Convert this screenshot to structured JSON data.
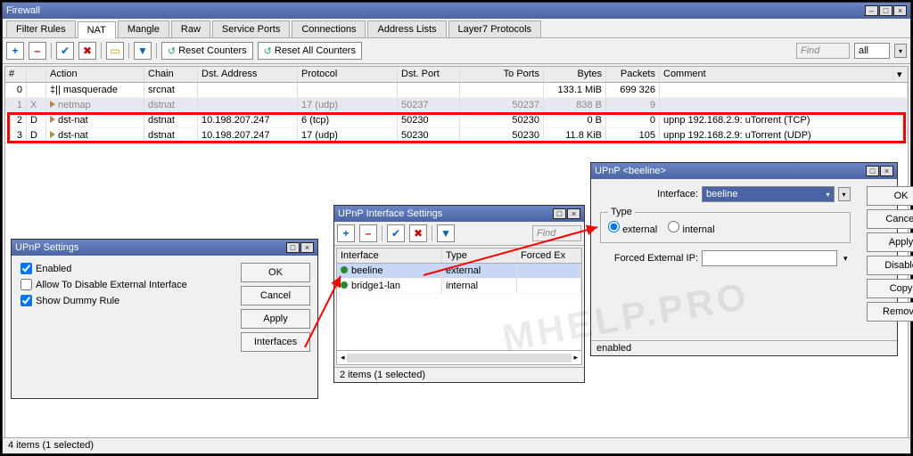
{
  "main": {
    "title": "Firewall",
    "tabs": [
      "Filter Rules",
      "NAT",
      "Mangle",
      "Raw",
      "Service Ports",
      "Connections",
      "Address Lists",
      "Layer7 Protocols"
    ],
    "active_tab": "NAT",
    "toolbar": {
      "reset_counters": "Reset Counters",
      "reset_all": "Reset All Counters",
      "find": "Find",
      "all": "all"
    },
    "columns": [
      "#",
      "",
      "Action",
      "Chain",
      "Dst. Address",
      "Protocol",
      "Dst. Port",
      "To Ports",
      "Bytes",
      "Packets",
      "Comment"
    ],
    "rows": [
      {
        "n": "0",
        "flag": "",
        "action": "‡|| masquerade",
        "chain": "srcnat",
        "dst": "",
        "proto": "",
        "dport": "",
        "to": "",
        "bytes": "133.1 MiB",
        "pkts": "699 326",
        "comment": ""
      },
      {
        "n": "1",
        "flag": "X",
        "action": "▸ netmap",
        "chain": "dstnat",
        "dst": "",
        "proto": "17 (udp)",
        "dport": "50237",
        "to": "50237",
        "bytes": "838 B",
        "pkts": "9",
        "comment": "",
        "dim": true,
        "sel": true
      },
      {
        "n": "2",
        "flag": "D",
        "action": "▸ dst-nat",
        "chain": "dstnat",
        "dst": "10.198.207.247",
        "proto": "6 (tcp)",
        "dport": "50230",
        "to": "50230",
        "bytes": "0 B",
        "pkts": "0",
        "comment": "upnp 192.168.2.9: uTorrent (TCP)"
      },
      {
        "n": "3",
        "flag": "D",
        "action": "▸ dst-nat",
        "chain": "dstnat",
        "dst": "10.198.207.247",
        "proto": "17 (udp)",
        "dport": "50230",
        "to": "50230",
        "bytes": "11.8 KiB",
        "pkts": "105",
        "comment": "upnp 192.168.2.9: uTorrent (UDP)"
      }
    ],
    "status": "4 items (1 selected)"
  },
  "upnp_settings": {
    "title": "UPnP Settings",
    "enabled": "Enabled",
    "allow_disable": "Allow To Disable External Interface",
    "show_dummy": "Show Dummy Rule",
    "ok": "OK",
    "cancel": "Cancel",
    "apply": "Apply",
    "interfaces": "Interfaces"
  },
  "iface_settings": {
    "title": "UPnP Interface Settings",
    "find": "Find",
    "columns": [
      "Interface",
      "Type",
      "Forced Ex"
    ],
    "rows": [
      {
        "iface": "beeline",
        "type": "external",
        "sel": true
      },
      {
        "iface": "bridge1-lan",
        "type": "internal"
      }
    ],
    "status": "2 items (1 selected)"
  },
  "upnp_detail": {
    "title": "UPnP <beeline>",
    "interface_label": "Interface:",
    "interface_value": "beeline",
    "type_label": "Type",
    "external": "external",
    "internal": "internal",
    "forced_label": "Forced External IP:",
    "ok": "OK",
    "cancel": "Cancel",
    "apply": "Apply",
    "disable": "Disable",
    "copy": "Copy",
    "remove": "Remove",
    "status": "enabled"
  },
  "watermark": "MHELP.PRO"
}
